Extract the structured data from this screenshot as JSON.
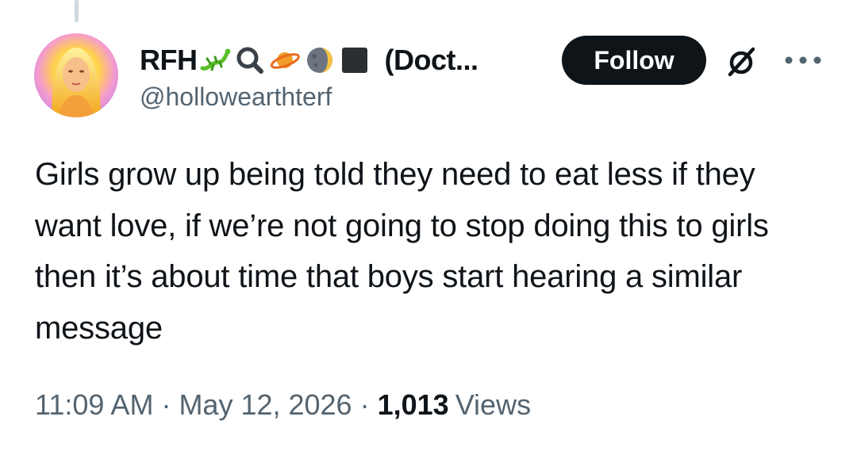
{
  "author": {
    "display_name": "RFH",
    "name_emojis": [
      "lizard-emoji",
      "magnifier-emoji",
      "ringed-planet-emoji",
      "moon-emoji",
      "black-square-emoji"
    ],
    "name_suffix": "(Doct...",
    "handle": "@hollowearthterf"
  },
  "actions": {
    "follow_label": "Follow",
    "grok_icon": "grok-icon",
    "more_icon": "more-options-icon"
  },
  "tweet": {
    "text": "Girls grow up being told they need to eat less if they want love, if we’re not going to stop doing this to girls then it’s about time that boys start hearing a similar message"
  },
  "meta": {
    "time": "11:09 AM",
    "separator": "·",
    "date": "May 12, 2026",
    "views_count": "1,013",
    "views_label": "Views"
  },
  "colors": {
    "text": "#0f1419",
    "secondary": "#536471",
    "follow_bg": "#0f1419",
    "follow_text": "#ffffff"
  }
}
